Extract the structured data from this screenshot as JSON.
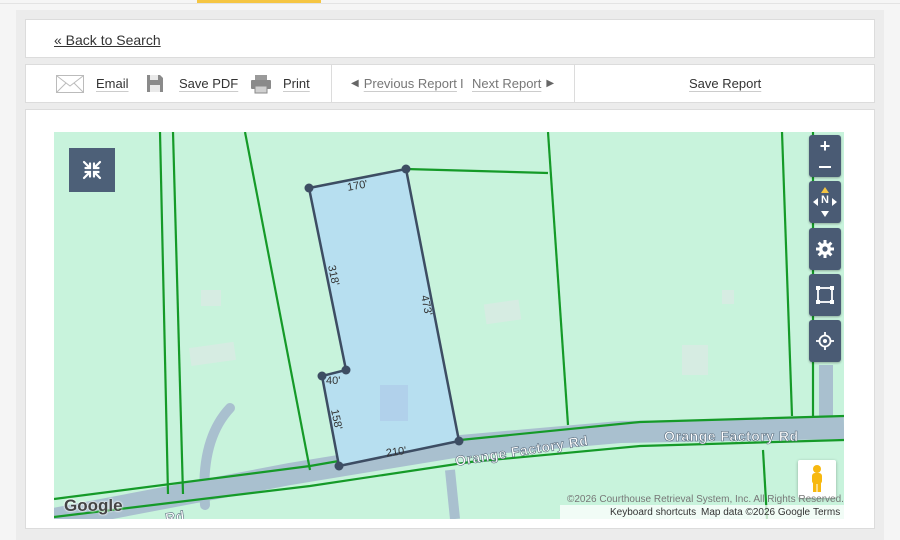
{
  "nav": {
    "back_label": "« Back to Search"
  },
  "toolbar": {
    "email_label": "Email",
    "save_pdf_label": "Save PDF",
    "print_label": "Print",
    "previous_label": "Previous Report",
    "separator": "I",
    "next_label": "Next Report",
    "save_report_label": "Save Report"
  },
  "map": {
    "parcel_dimensions": [
      "170'",
      "473'",
      "210'",
      "158'",
      "40'",
      "318'"
    ],
    "road_label_1": "Orange Factory Rd",
    "road_label_2": "Orange Factory Rd",
    "road_label_3": "Rd",
    "compass_label": "N",
    "google_logo": "Google",
    "copyright": "©2026 Courthouse Retrieval System, Inc. All Rights Reserved.",
    "keyboard_shortcuts": "Keyboard shortcuts",
    "map_data": "Map data ©2026 Google",
    "terms": "Terms",
    "icons": [
      "collapse-icon",
      "zoom-in-icon",
      "zoom-out-icon",
      "compass-icon",
      "settings-gear-icon",
      "select-area-icon",
      "locate-icon",
      "street-view-pegman-icon"
    ]
  },
  "colors": {
    "map_background": "#c8f3dc",
    "parcel_fill": "#b7dff0",
    "parcel_outline": "#3d4d63",
    "lot_lines": "#159a28",
    "road": "#a9c0cf",
    "control_buttons": "#4a5b74",
    "accent": "#f5c542"
  }
}
